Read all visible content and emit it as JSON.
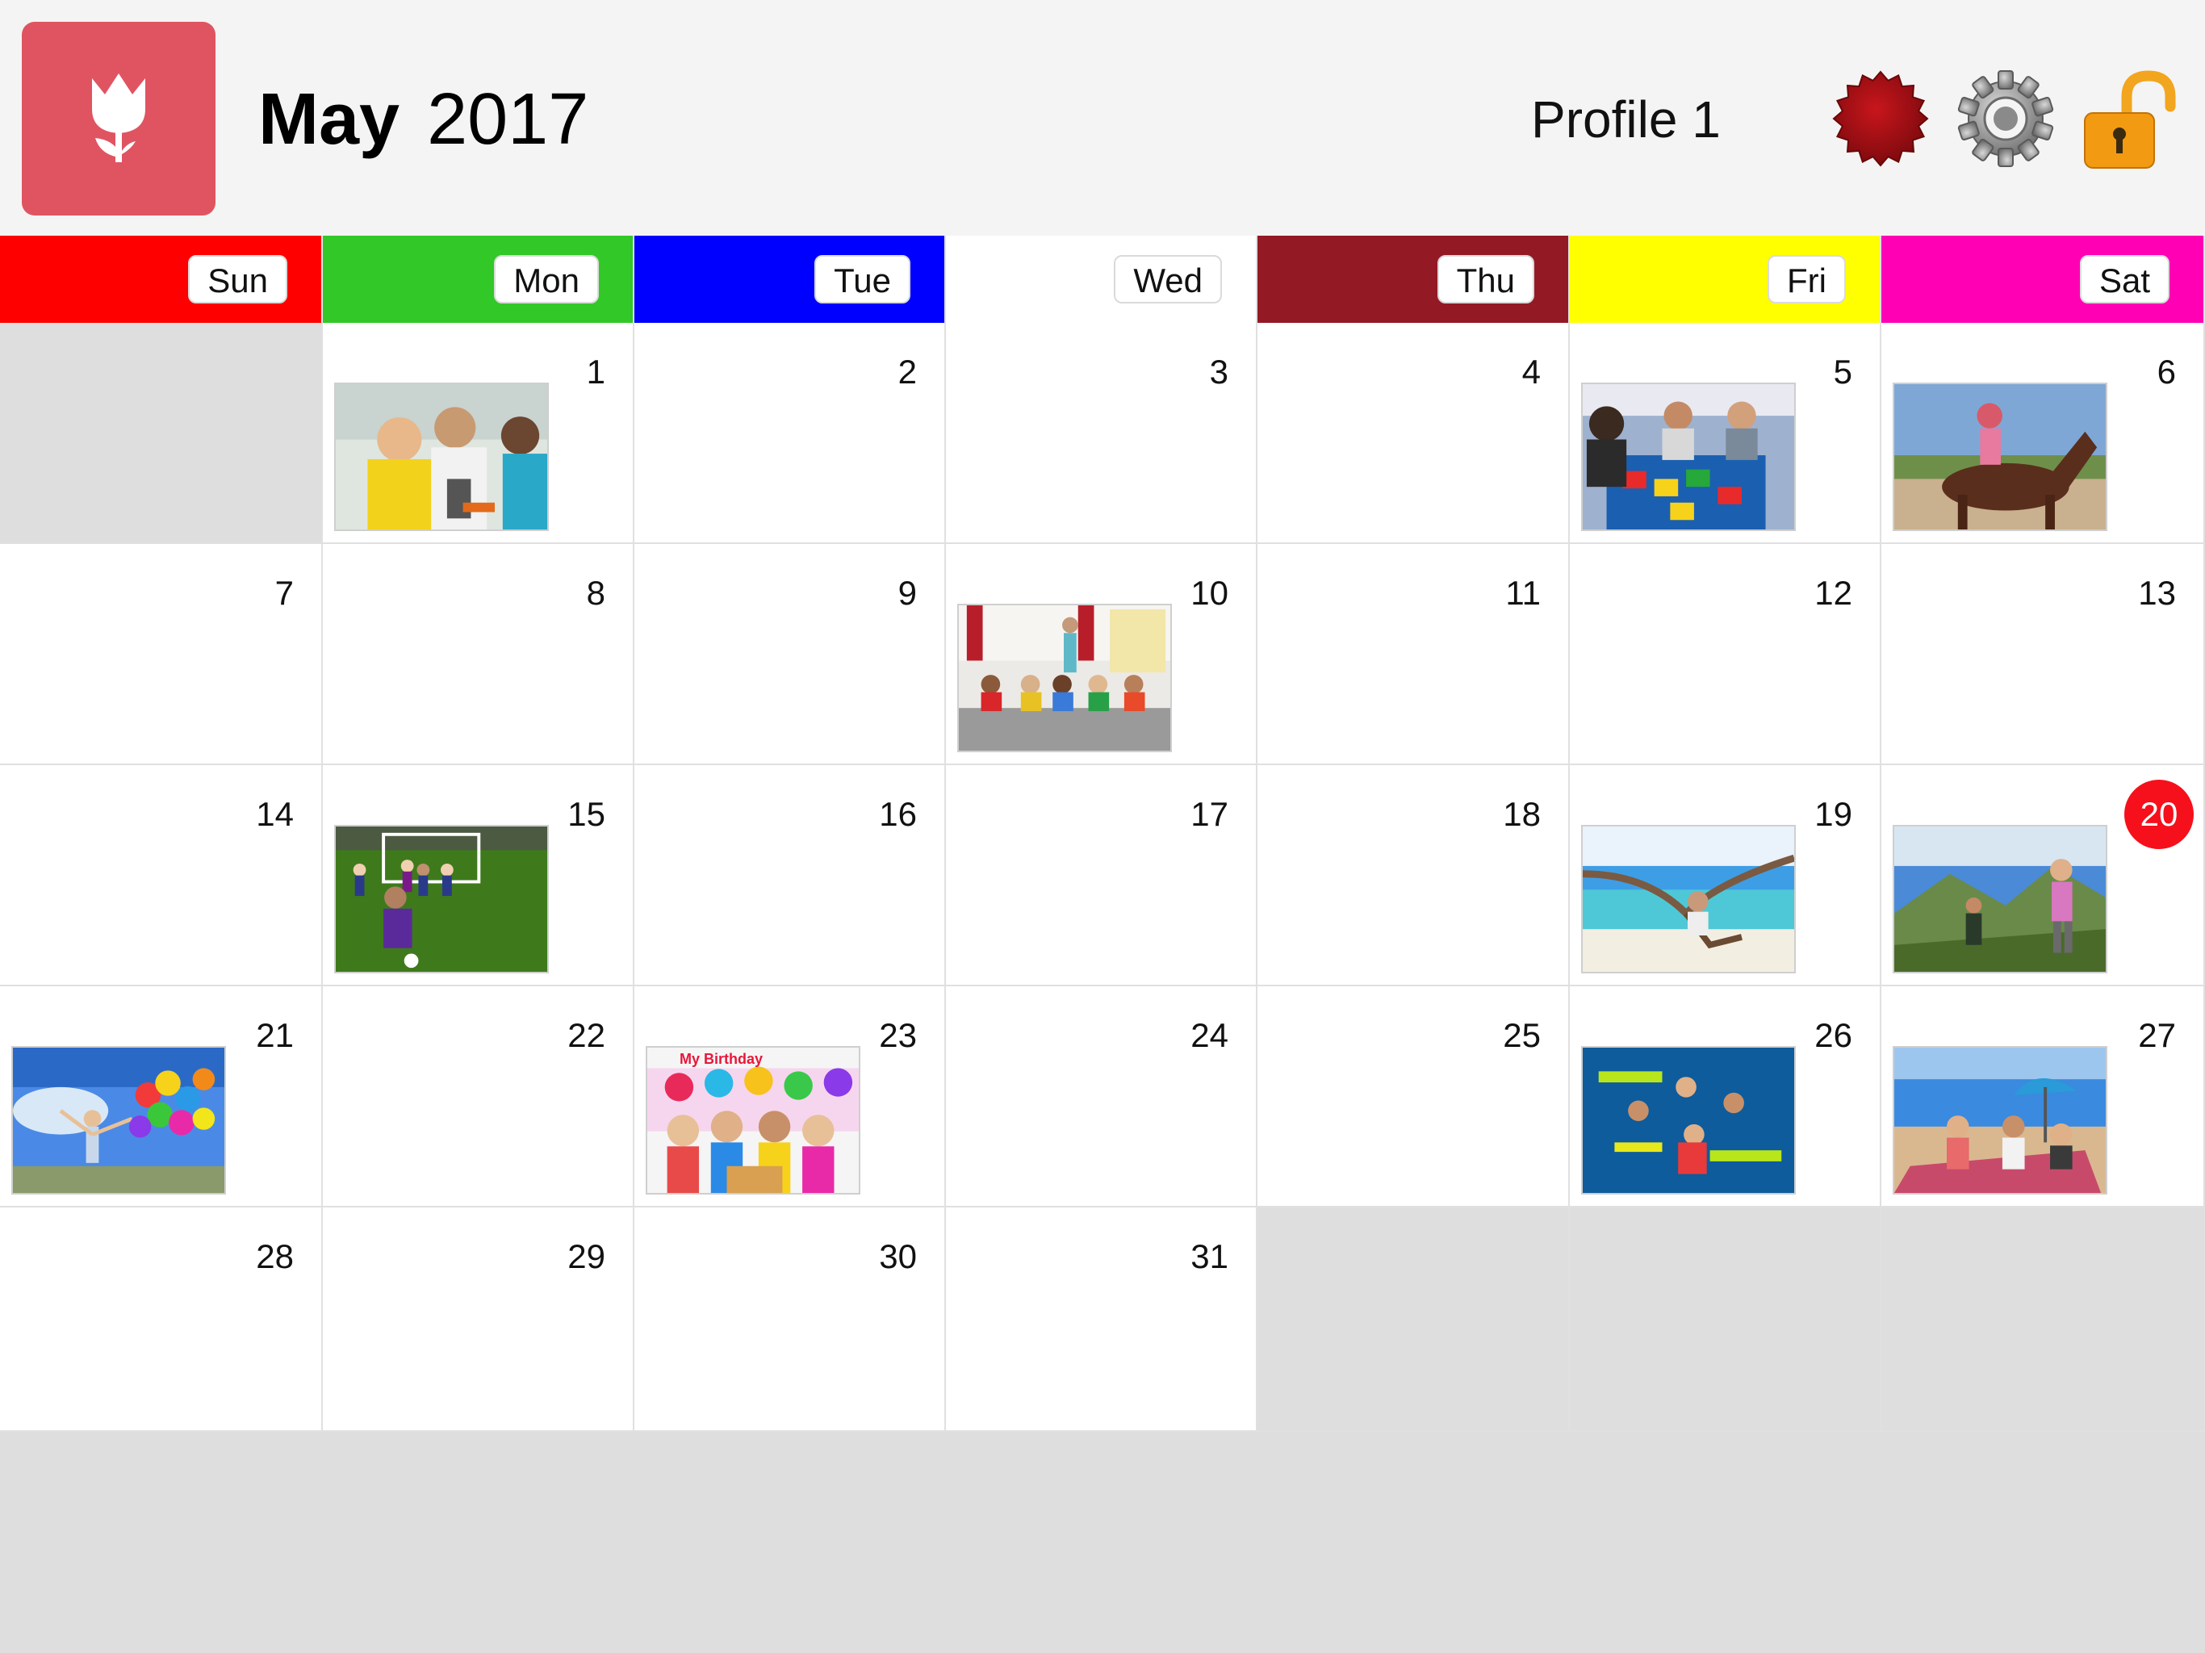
{
  "header": {
    "month": "May",
    "year": "2017",
    "profile": "Profile 1",
    "logo_icon": "tulip-icon",
    "icons": [
      "red-seal-badge-icon",
      "gear-icon",
      "unlocked-padlock-icon"
    ]
  },
  "colors": {
    "logo": "#e05461",
    "today": "#f5101c",
    "sun": "#ff0000",
    "mon": "#32c828",
    "tue": "#0000ff",
    "wed": "#ffffff",
    "thu": "#931a24",
    "fri": "#ffff00",
    "sat": "#ff00b4"
  },
  "weekdays": [
    "Sun",
    "Mon",
    "Tue",
    "Wed",
    "Thu",
    "Fri",
    "Sat"
  ],
  "days": [
    {
      "label": "1",
      "photo": "science-class"
    },
    {
      "label": "2"
    },
    {
      "label": "3"
    },
    {
      "label": "4"
    },
    {
      "label": "5",
      "photo": "classroom-blocks"
    },
    {
      "label": "6",
      "photo": "horse-riding"
    },
    {
      "label": "7"
    },
    {
      "label": "8"
    },
    {
      "label": "9"
    },
    {
      "label": "10",
      "photo": "circle-time"
    },
    {
      "label": "11"
    },
    {
      "label": "12"
    },
    {
      "label": "13"
    },
    {
      "label": "14"
    },
    {
      "label": "15",
      "photo": "soccer"
    },
    {
      "label": "16"
    },
    {
      "label": "17"
    },
    {
      "label": "18"
    },
    {
      "label": "19",
      "photo": "beach-tree"
    },
    {
      "label": "20",
      "photo": "mountain-hike",
      "today": true
    },
    {
      "label": "21",
      "photo": "balloons"
    },
    {
      "label": "22"
    },
    {
      "label": "23",
      "photo": "birthday",
      "caption": "My Birthday"
    },
    {
      "label": "24"
    },
    {
      "label": "25"
    },
    {
      "label": "26",
      "photo": "swimming-pool"
    },
    {
      "label": "27",
      "photo": "beach-picnic"
    },
    {
      "label": "28"
    },
    {
      "label": "29"
    },
    {
      "label": "30"
    },
    {
      "label": "31"
    }
  ]
}
